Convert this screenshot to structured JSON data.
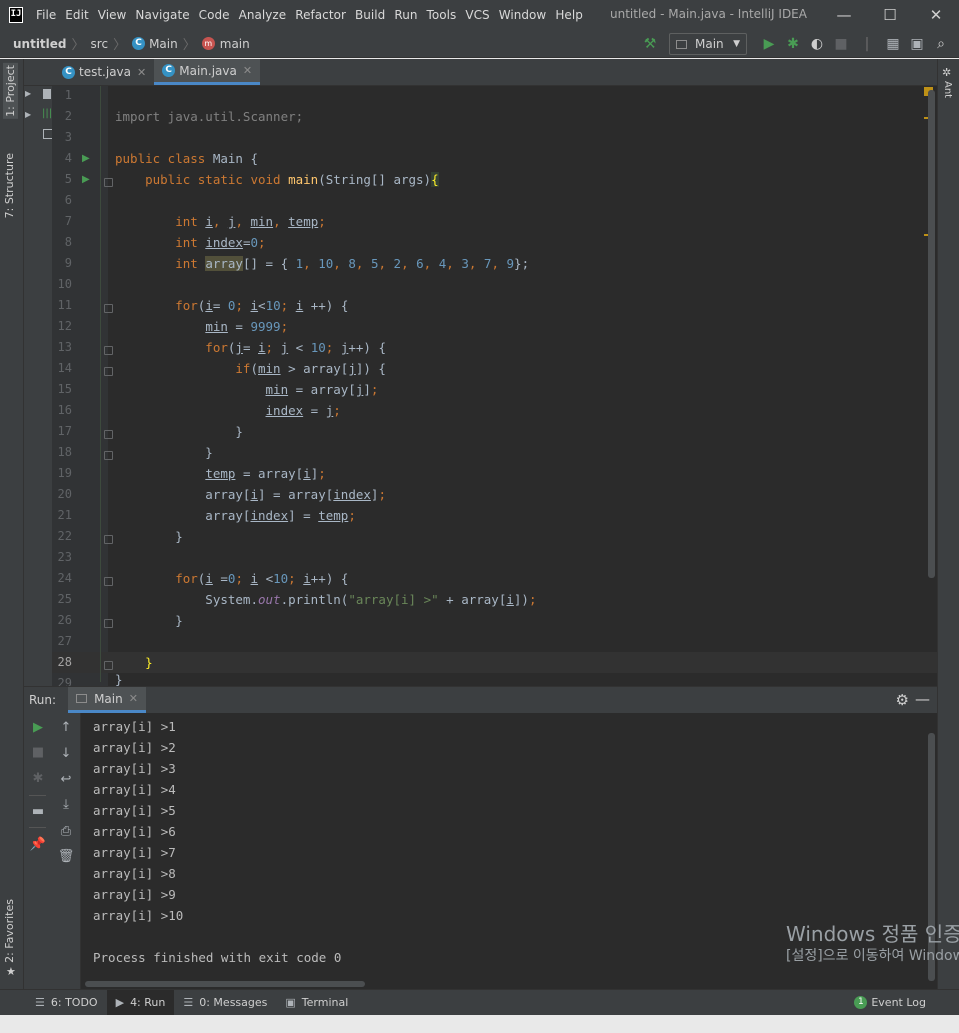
{
  "app": {
    "window_title": "untitled - Main.java - IntelliJ IDEA",
    "icon_label": "IJ"
  },
  "menu": [
    "File",
    "Edit",
    "View",
    "Navigate",
    "Code",
    "Analyze",
    "Refactor",
    "Build",
    "Run",
    "Tools",
    "VCS",
    "Window",
    "Help"
  ],
  "breadcrumbs": {
    "project": "untitled",
    "folder": "src",
    "class": "Main",
    "method": "main"
  },
  "toolbar": {
    "run_config": "Main"
  },
  "side_tabs": {
    "project": "1: Project",
    "structure": "7: Structure",
    "favorites": "2: Favorites",
    "ant": "Ant"
  },
  "editor_tabs": [
    {
      "label": "test.java",
      "active": false
    },
    {
      "label": "Main.java",
      "active": true
    }
  ],
  "editor": {
    "line_numbers": [
      "1",
      "2",
      "3",
      "4",
      "5",
      "6",
      "7",
      "8",
      "9",
      "10",
      "11",
      "12",
      "13",
      "14",
      "15",
      "16",
      "17",
      "18",
      "19",
      "20",
      "21",
      "22",
      "23",
      "24",
      "25",
      "26",
      "27",
      "28",
      "29"
    ],
    "code": {
      "l2": "import java.util.Scanner;",
      "l4a": "public class ",
      "l4b": "Main {",
      "l5a": "    public static void ",
      "l5b": "main",
      "l5c": "(String[] args)",
      "l5d": "{",
      "l7a": "        int ",
      "l7b": "i",
      "l7c": ", ",
      "l7d": "j",
      "l7e": ", ",
      "l7f": "min",
      "l7g": ", ",
      "l7h": "temp",
      "l7i": ";",
      "l8a": "        int ",
      "l8b": "index",
      "l8c": "=",
      "l8d": "0",
      "l8e": ";",
      "l9a": "        int ",
      "l9b": "array",
      "l9c": "[] = { ",
      "l9d": "1",
      "l9e": ", ",
      "l9f": "10",
      "l9g": ", ",
      "l9h": "8",
      "l9i": ", ",
      "l9j": "5",
      "l9k": ", ",
      "l9l": "2",
      "l9m": ", ",
      "l9n": "6",
      "l9o": ", ",
      "l9p": "4",
      "l9q": ", ",
      "l9r": "3",
      "l9s": ", ",
      "l9t": "7",
      "l9u": ", ",
      "l9v": "9",
      "l9w": "};",
      "l11a": "        for",
      "l11b": "(",
      "l11c": "i",
      "l11d": "= ",
      "l11e": "0",
      "l11f": "; ",
      "l11g": "i",
      "l11h": "<",
      "l11i": "10",
      "l11j": "; ",
      "l11k": "i",
      "l11l": " ++) {",
      "l12a": "            ",
      "l12b": "min",
      "l12c": " = ",
      "l12d": "9999",
      "l12e": ";",
      "l13a": "            for",
      "l13b": "(",
      "l13c": "j",
      "l13d": "= ",
      "l13e": "i",
      "l13f": "; ",
      "l13g": "j",
      "l13h": " < ",
      "l13i": "10",
      "l13j": "; ",
      "l13k": "j",
      "l13l": "++) {",
      "l14a": "                if",
      "l14b": "(",
      "l14c": "min",
      "l14d": " > array[",
      "l14e": "j",
      "l14f": "]) {",
      "l15a": "                    ",
      "l15b": "min",
      "l15c": " = array[",
      "l15d": "j",
      "l15e": "]",
      "l15f": ";",
      "l16a": "                    ",
      "l16b": "index",
      "l16c": " = ",
      "l16d": "j",
      "l16e": ";",
      "l17": "                }",
      "l18": "            }",
      "l19a": "            ",
      "l19b": "temp",
      "l19c": " = array[",
      "l19d": "i",
      "l19e": "]",
      "l19f": ";",
      "l20a": "            array[",
      "l20b": "i",
      "l20c": "] = array[",
      "l20d": "index",
      "l20e": "]",
      "l20f": ";",
      "l21a": "            array[",
      "l21b": "index",
      "l21c": "] = ",
      "l21d": "temp",
      "l21e": ";",
      "l22": "        }",
      "l24a": "        for",
      "l24b": "(",
      "l24c": "i",
      "l24d": " =",
      "l24e": "0",
      "l24f": "; ",
      "l24g": "i",
      "l24h": " <",
      "l24i": "10",
      "l24j": "; ",
      "l24k": "i",
      "l24l": "++) {",
      "l25a": "            System.",
      "l25b": "out",
      "l25c": ".println(",
      "l25d": "\"array[i] >\"",
      "l25e": " + array[",
      "l25f": "i",
      "l25g": "])",
      "l25h": ";",
      "l26": "        }",
      "l28": "    }",
      "l29": "}"
    }
  },
  "run_panel": {
    "label": "Run:",
    "tab": "Main",
    "output": [
      "array[i] >1",
      "array[i] >2",
      "array[i] >3",
      "array[i] >4",
      "array[i] >5",
      "array[i] >6",
      "array[i] >7",
      "array[i] >8",
      "array[i] >9",
      "array[i] >10",
      "",
      "Process finished with exit code 0"
    ]
  },
  "watermark": {
    "line1": "Windows 정품 인증",
    "line2": "[설정]으로 이동하여 Windows"
  },
  "bottom_tools": [
    {
      "label": "6: TODO",
      "icon": "list-icon"
    },
    {
      "label": "4: Run",
      "icon": "run-icon"
    },
    {
      "label": "0: Messages",
      "icon": "messages-icon"
    },
    {
      "label": "Terminal",
      "icon": "terminal-icon"
    }
  ],
  "event_log": {
    "count": "1",
    "label": "Event Log"
  },
  "colors": {
    "keyword": "#cc7832",
    "number": "#6897bb",
    "string": "#6a8759",
    "method": "#ffc66d",
    "static_field": "#9876aa",
    "run_green": "#499c54",
    "tab_accent": "#4a88c7"
  }
}
